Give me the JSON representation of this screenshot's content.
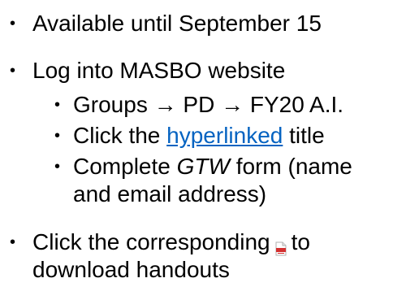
{
  "bullets": {
    "item1": "Available until September 15",
    "item2": "Log into MASBO website",
    "sub1": {
      "part1": "Groups ",
      "arrow1": "→",
      "part2": " PD ",
      "arrow2": "→",
      "part3": " FY20 A.I."
    },
    "sub2": {
      "before": "Click the ",
      "link": "hyperlinked",
      "after": " title"
    },
    "sub3": {
      "before": "Complete ",
      "italic": "GTW",
      "after": " form (name",
      "line2": "and email address)"
    },
    "item3": {
      "before": "Click the corresponding",
      "after": "to",
      "line2": "download handouts"
    }
  },
  "bullet_char": "•",
  "icons": {
    "pdf": "pdf-file-icon"
  },
  "colors": {
    "link": "#0563c1",
    "pdf_icon": "#d32f2f"
  }
}
